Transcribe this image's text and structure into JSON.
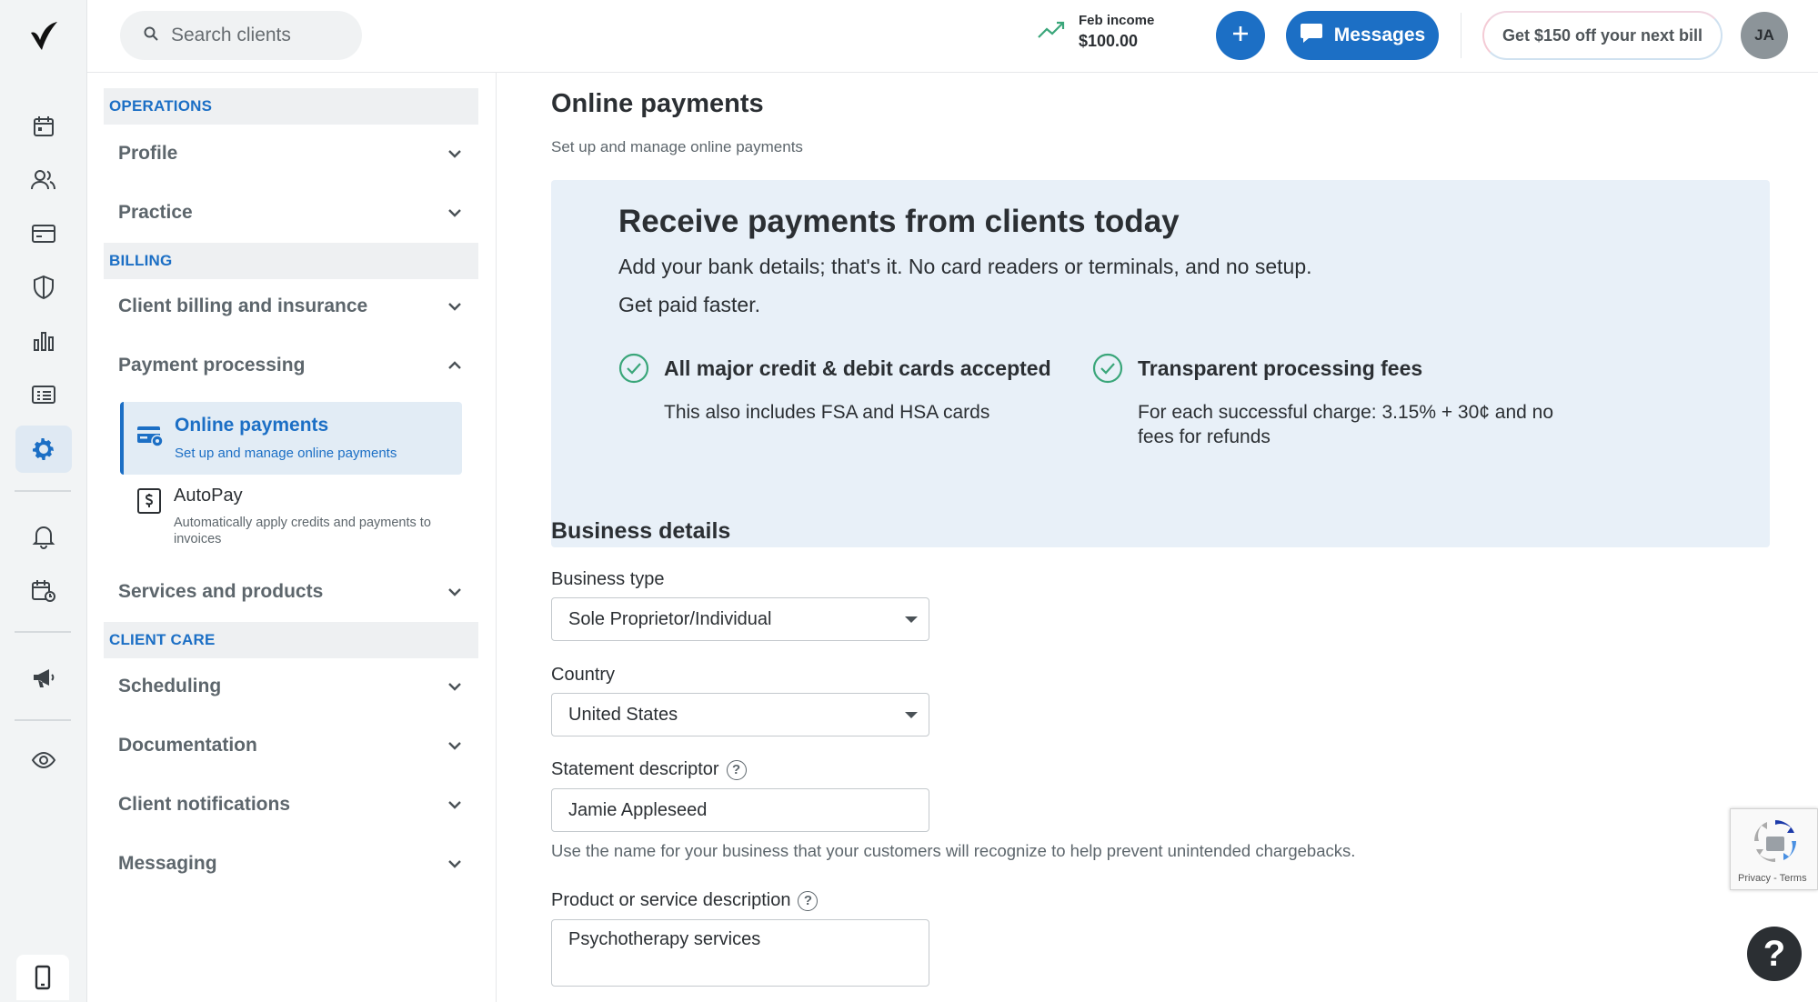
{
  "header": {
    "search_placeholder": "Search clients",
    "income_label": "Feb income",
    "income_value": "$100.00",
    "messages_label": "Messages",
    "promo_label": "Get $150 off your next bill",
    "avatar_initials": "JA"
  },
  "rail": {
    "icons": [
      "logo-icon",
      "calendar-icon",
      "clients-icon",
      "billing-card-icon",
      "insurance-shield-icon",
      "analytics-icon",
      "list-icon",
      "settings-gear-icon",
      "bell-icon",
      "calendar-clock-icon",
      "megaphone-icon",
      "eye-icon",
      "mobile-phone-icon"
    ],
    "active": "settings-gear-icon"
  },
  "sidebar": {
    "sections": [
      {
        "heading": "OPERATIONS",
        "items": [
          "Profile",
          "Practice"
        ]
      },
      {
        "heading": "BILLING",
        "items": [
          "Client billing and insurance",
          "Payment processing",
          "Services and products"
        ]
      },
      {
        "heading": "CLIENT CARE",
        "items": [
          "Scheduling",
          "Documentation",
          "Client notifications",
          "Messaging"
        ]
      }
    ],
    "active_sub": {
      "title": "Online payments",
      "desc": "Set up and manage online payments"
    },
    "sub": {
      "title": "AutoPay",
      "desc": "Automatically apply credits and payments to invoices"
    }
  },
  "main": {
    "title": "Online payments",
    "subtitle": "Set up and manage online payments",
    "banner": {
      "heading": "Receive payments from clients today",
      "line1": "Add your bank details; that's it. No card readers or terminals, and no setup.",
      "line2": "Get paid faster.",
      "feature1_title": "All major credit & debit cards accepted",
      "feature1_desc": "This also includes FSA and HSA cards",
      "feature2_title": "Transparent processing fees",
      "feature2_desc": "For each successful charge: 3.15% + 30¢ and no fees for refunds"
    },
    "business": {
      "title": "Business details",
      "business_type_label": "Business type",
      "business_type_value": "Sole Proprietor/Individual",
      "country_label": "Country",
      "country_value": "United States",
      "descriptor_label": "Statement descriptor",
      "descriptor_value": "Jamie Appleseed",
      "descriptor_hint": "Use the name for your business that your customers will recognize to help prevent unintended chargebacks.",
      "product_label": "Product or service description",
      "product_value": "Psychotherapy services"
    }
  },
  "recaptcha": {
    "links": "Privacy - Terms"
  },
  "help_label": "?",
  "colors": {
    "accent": "#1c6fc5",
    "banner_bg": "#e8f0f8",
    "check": "#3aa67a"
  }
}
